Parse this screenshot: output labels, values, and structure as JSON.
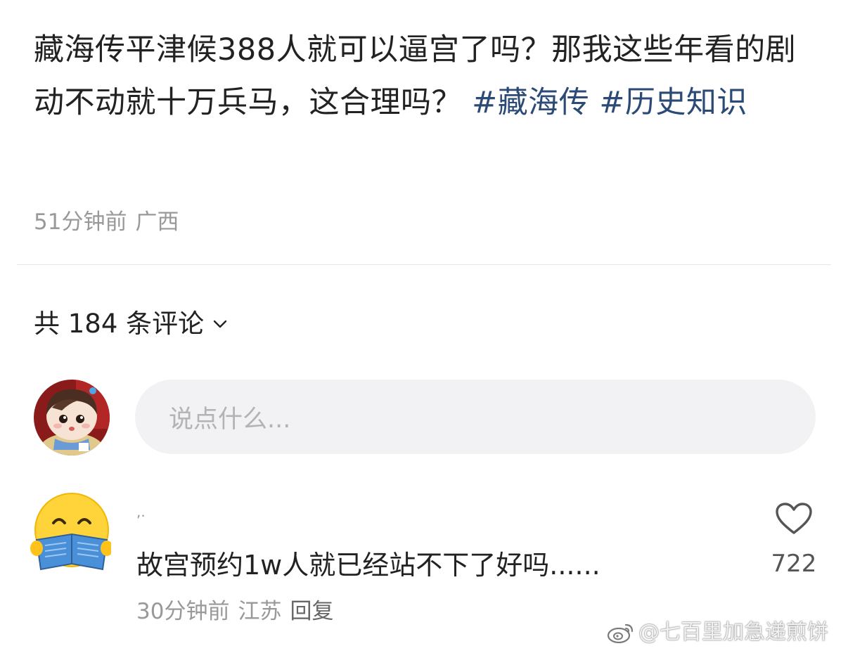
{
  "post": {
    "text": "藏海传平津候388人就可以逼宫了吗？那我这些年看的剧动不动就十万兵马，这合理吗？",
    "hashtags": [
      "#藏海传",
      "#历史知识"
    ],
    "time": "51分钟前",
    "location": "广西"
  },
  "comments_section": {
    "header": "共 184 条评论",
    "input_placeholder": "说点什么..."
  },
  "comments": [
    {
      "username": ",.",
      "text": "故宫预约1w人就已经站不下了好吗......",
      "time": "30分钟前",
      "location": "江苏",
      "reply_label": "回复",
      "likes": "722"
    }
  ],
  "watermark": "@七百里加急递煎饼",
  "colors": {
    "hashtag": "#2b4a75",
    "meta_gray": "#999999",
    "input_bg": "#f2f2f4"
  },
  "icons": [
    "chevron-down-icon",
    "heart-outline-icon",
    "weibo-logo-icon"
  ]
}
